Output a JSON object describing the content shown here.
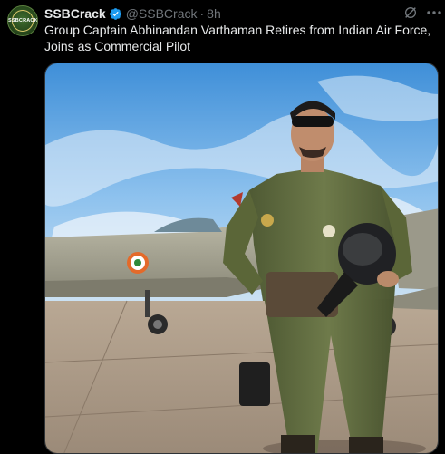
{
  "post": {
    "author_name": "SSBCrack",
    "handle": "@SSBCrack",
    "separator": "·",
    "time": "8h",
    "text": "Group Captain Abhinandan Varthaman Retires from Indian Air Force, Joins as Commercial Pilot",
    "avatar_text": "SSBCRACK",
    "verified": true
  },
  "icons": {
    "verified": "verified-badge-icon",
    "grok": "grok-icon",
    "more": "more-icon"
  },
  "colors": {
    "background": "#000000",
    "text": "#e7e9ea",
    "secondary": "#71767b",
    "verified": "#1d9bf0"
  },
  "media": {
    "kind": "photo",
    "subject": "pilot in flight suit standing in front of a fighter jet"
  }
}
